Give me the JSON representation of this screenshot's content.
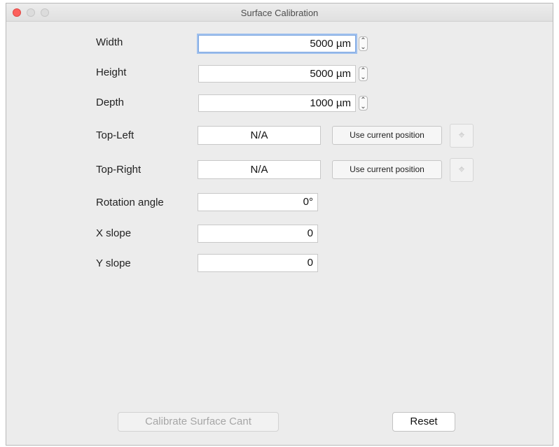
{
  "window": {
    "title": "Surface Calibration"
  },
  "form": {
    "width": {
      "label": "Width",
      "value": "5000 µm"
    },
    "height": {
      "label": "Height",
      "value": "5000 µm"
    },
    "depth": {
      "label": "Depth",
      "value": "1000 µm"
    },
    "top_left": {
      "label": "Top-Left",
      "value": "N/A",
      "button": "Use current position"
    },
    "top_right": {
      "label": "Top-Right",
      "value": "N/A",
      "button": "Use current position"
    },
    "rotation": {
      "label": "Rotation angle",
      "value": "0°"
    },
    "x_slope": {
      "label": "X slope",
      "value": "0"
    },
    "y_slope": {
      "label": "Y slope",
      "value": "0"
    }
  },
  "footer": {
    "calibrate_label": "Calibrate Surface Cant",
    "reset_label": "Reset"
  },
  "icons": {
    "stepper": "stepper-icon",
    "crosshair": "crosshair-icon"
  },
  "colors": {
    "close_button": "#fc605c",
    "focus_ring": "#9fc0ee",
    "window_bg": "#ececec"
  }
}
